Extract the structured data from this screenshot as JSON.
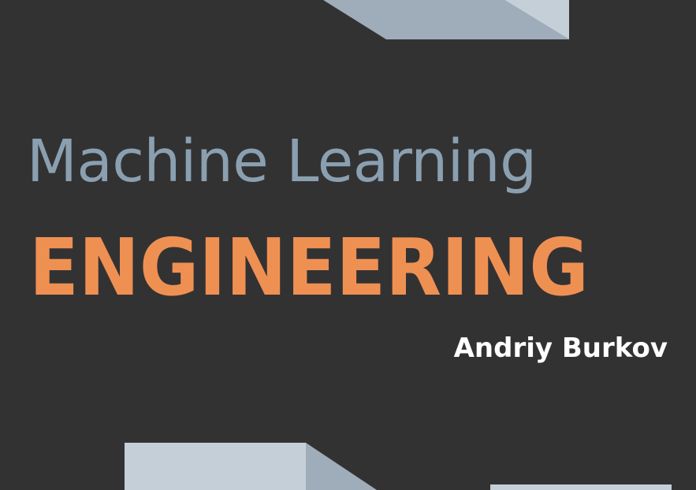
{
  "cover": {
    "title_line1": "Machine Learning",
    "title_line2": "ENGINEERING",
    "author": "Andriy Burkov"
  },
  "colors": {
    "background": "#333233",
    "title_line1": "#8aa0b0",
    "title_line2": "#ef9053",
    "author": "#ffffff",
    "block_light": "#c5cfd8",
    "block_mid": "#9fadba"
  }
}
